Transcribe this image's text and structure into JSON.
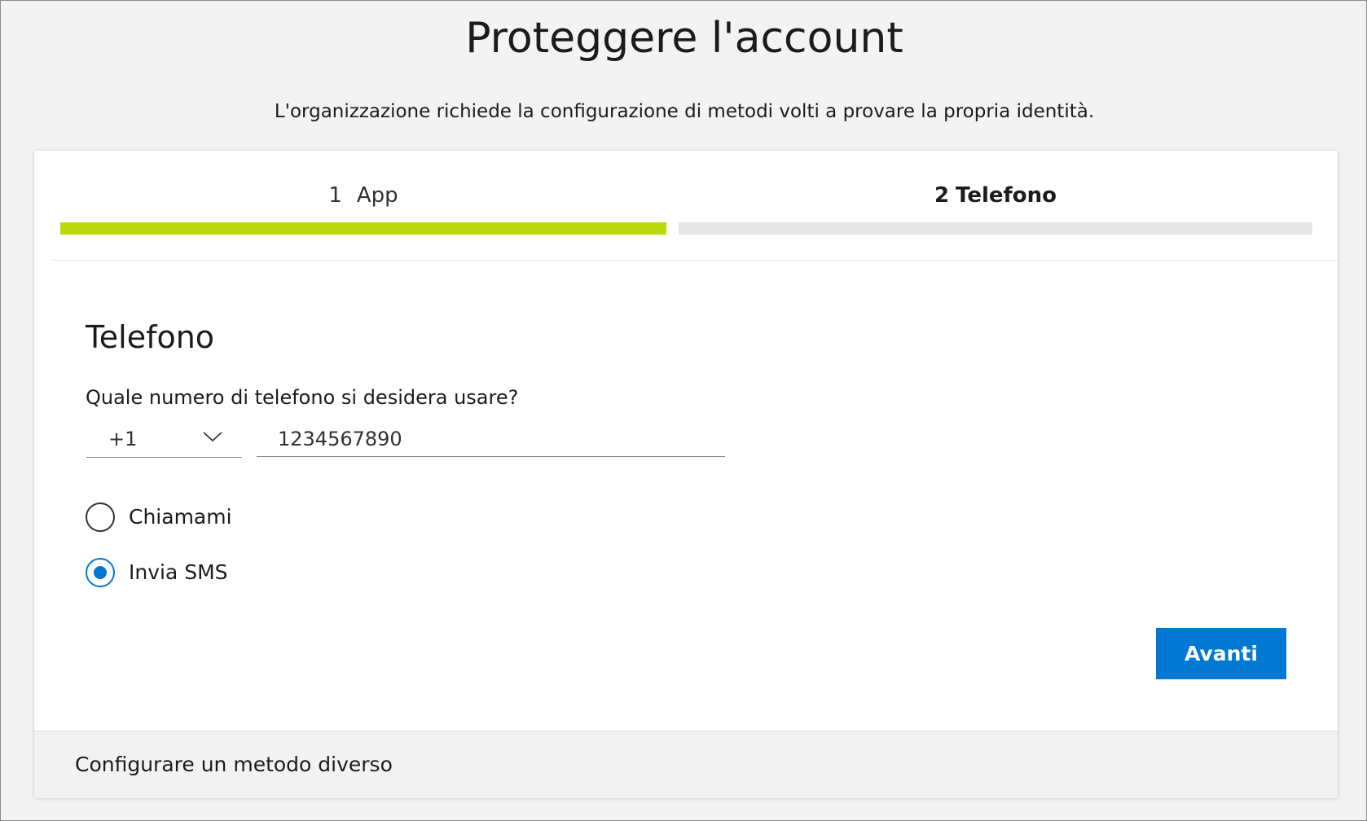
{
  "header": {
    "title": "Proteggere l'account",
    "subtitle": "L'organizzazione richiede la configurazione di metodi volti a provare la propria identità."
  },
  "steps": [
    {
      "number": "1",
      "label": "App",
      "state": "completed",
      "bar_color": "#bad80a"
    },
    {
      "number": "2",
      "label": "Telefono",
      "state": "current",
      "bar_color": "#e6e6e6"
    }
  ],
  "phone_section": {
    "heading": "Telefono",
    "question": "Quale numero di telefono si desidera usare?",
    "country_code": {
      "selected": "+1",
      "icon": "chevron-down-icon"
    },
    "phone_number": {
      "value": "1234567890"
    },
    "methods": [
      {
        "label": "Chiamami",
        "checked": false
      },
      {
        "label": "Invia SMS",
        "checked": true
      }
    ]
  },
  "actions": {
    "next_label": "Avanti",
    "next_color": "#0078d4"
  },
  "footer": {
    "different_method_label": "Configurare un metodo diverso"
  }
}
